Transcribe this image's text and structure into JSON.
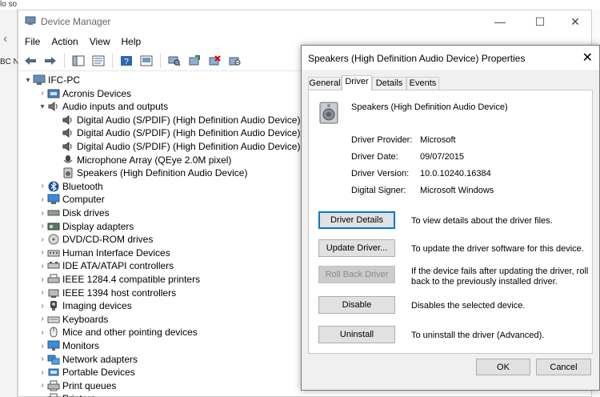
{
  "background": {
    "fragment_top": "lo so",
    "fragment_left": "BC N"
  },
  "window": {
    "title": "Device Manager",
    "controls": [
      "—",
      "☐",
      "✕"
    ]
  },
  "menu": [
    "File",
    "Action",
    "View",
    "Help"
  ],
  "toolbar": {
    "icons": [
      "back-icon",
      "forward-icon",
      "show-hide-console-tree-icon",
      "properties-icon",
      "help-icon",
      "console-icon",
      "scan-hardware-icon",
      "update-driver-icon",
      "uninstall-icon",
      "disable-icon"
    ]
  },
  "tree": {
    "root": "IFC-PC",
    "items": [
      {
        "label": "Acronis Devices",
        "level": 1,
        "expanded": false,
        "icon": "acronis-icon"
      },
      {
        "label": "Audio inputs and outputs",
        "level": 1,
        "expanded": true,
        "icon": "audio-icon"
      },
      {
        "label": "Digital Audio (S/PDIF) (High Definition Audio Device)",
        "level": 2,
        "icon": "audio-device-icon"
      },
      {
        "label": "Digital Audio (S/PDIF) (High Definition Audio Device)",
        "level": 2,
        "icon": "audio-device-icon"
      },
      {
        "label": "Digital Audio (S/PDIF) (High Definition Audio Device)",
        "level": 2,
        "icon": "audio-device-icon"
      },
      {
        "label": "Microphone Array (QEye 2.0M pixel)",
        "level": 2,
        "icon": "microphone-icon"
      },
      {
        "label": "Speakers (High Definition Audio Device)",
        "level": 2,
        "icon": "speaker-icon"
      },
      {
        "label": "Bluetooth",
        "level": 1,
        "expanded": false,
        "icon": "bluetooth-icon"
      },
      {
        "label": "Computer",
        "level": 1,
        "expanded": false,
        "icon": "computer-icon"
      },
      {
        "label": "Disk drives",
        "level": 1,
        "expanded": false,
        "icon": "disk-icon"
      },
      {
        "label": "Display adapters",
        "level": 1,
        "expanded": false,
        "icon": "display-adapter-icon"
      },
      {
        "label": "DVD/CD-ROM drives",
        "level": 1,
        "expanded": false,
        "icon": "dvd-icon"
      },
      {
        "label": "Human Interface Devices",
        "level": 1,
        "expanded": false,
        "icon": "hid-icon"
      },
      {
        "label": "IDE ATA/ATAPI controllers",
        "level": 1,
        "expanded": false,
        "icon": "ide-icon"
      },
      {
        "label": "IEEE 1284.4 compatible printers",
        "level": 1,
        "expanded": false,
        "icon": "printer-port-icon"
      },
      {
        "label": "IEEE 1394 host controllers",
        "level": 1,
        "expanded": false,
        "icon": "firewire-icon"
      },
      {
        "label": "Imaging devices",
        "level": 1,
        "expanded": false,
        "icon": "camera-icon"
      },
      {
        "label": "Keyboards",
        "level": 1,
        "expanded": false,
        "icon": "keyboard-icon"
      },
      {
        "label": "Mice and other pointing devices",
        "level": 1,
        "expanded": false,
        "icon": "mouse-icon"
      },
      {
        "label": "Monitors",
        "level": 1,
        "expanded": false,
        "icon": "monitor-icon"
      },
      {
        "label": "Network adapters",
        "level": 1,
        "expanded": false,
        "icon": "network-icon"
      },
      {
        "label": "Portable Devices",
        "level": 1,
        "expanded": false,
        "icon": "portable-device-icon"
      },
      {
        "label": "Print queues",
        "level": 1,
        "expanded": false,
        "icon": "print-queue-icon"
      },
      {
        "label": "Printers",
        "level": 1,
        "expanded": false,
        "icon": "printer-icon"
      }
    ]
  },
  "dialog": {
    "title": "Speakers (High Definition Audio Device) Properties",
    "close": "✕",
    "tabs": [
      "General",
      "Driver",
      "Details",
      "Events"
    ],
    "active_tab": "Driver",
    "device_name": "Speakers (High Definition Audio Device)",
    "fields": [
      {
        "label": "Driver Provider:",
        "value": "Microsoft"
      },
      {
        "label": "Driver Date:",
        "value": "09/07/2015"
      },
      {
        "label": "Driver Version:",
        "value": "10.0.10240.16384"
      },
      {
        "label": "Digital Signer:",
        "value": "Microsoft Windows"
      }
    ],
    "actions": [
      {
        "button": "Driver Details",
        "description": "To view details about the driver files."
      },
      {
        "button": "Update Driver...",
        "description": "To update the driver software for this device."
      },
      {
        "button": "Roll Back Driver",
        "description": "If the device fails after updating the driver, roll back to the previously installed driver.",
        "disabled": true
      },
      {
        "button": "Disable",
        "description": "Disables the selected device."
      },
      {
        "button": "Uninstall",
        "description": "To uninstall the driver (Advanced)."
      }
    ],
    "ok": "OK",
    "cancel": "Cancel"
  },
  "colors": {
    "accent": "#0078d7",
    "window_bg": "#ffffff",
    "dialog_bg": "#f0f0f0"
  }
}
